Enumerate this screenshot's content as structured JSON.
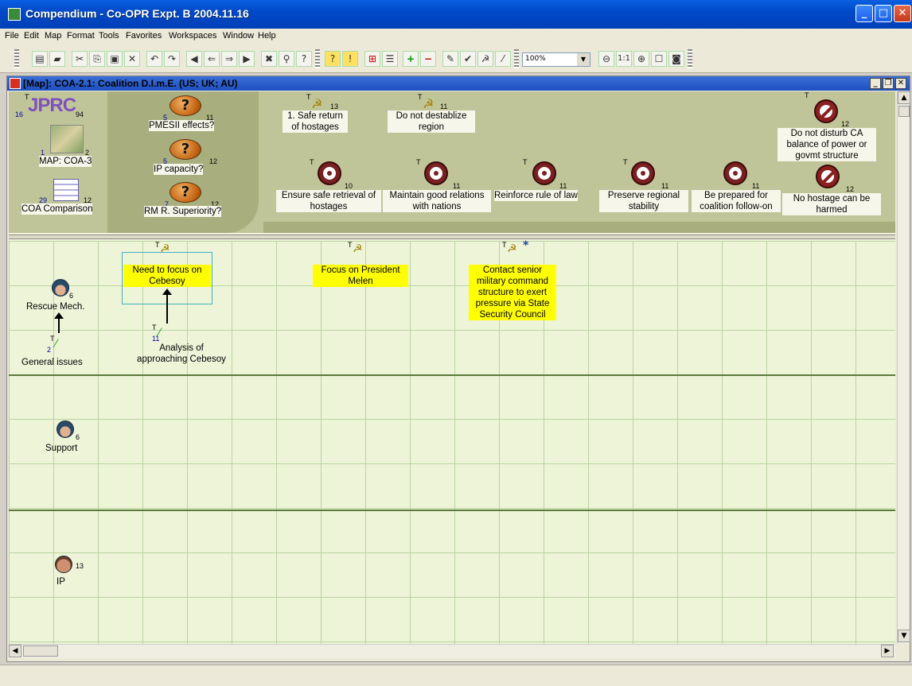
{
  "window": {
    "title": "Compendium - Co-OPR Expt. B 2004.11.16",
    "buttons": {
      "minimize": "_",
      "maximize": "□",
      "close": "✕"
    }
  },
  "menu": [
    "File",
    "Edit",
    "Map",
    "Format",
    "Tools",
    "Favorites",
    "Workspaces",
    "Window",
    "Help"
  ],
  "toolbar": {
    "zoom_value": "100%",
    "zoom_one_to_one": "1:1",
    "icons": [
      "open-folder-icon",
      "open-icon",
      "cut-icon",
      "copy-icon",
      "paste-icon",
      "delete-icon",
      "undo-icon",
      "redo-icon",
      "back-icon",
      "back-arrow-icon",
      "forward-arrow-icon",
      "forward-icon",
      "map-icon",
      "search-icon",
      "help-icon",
      "question-node-icon",
      "idea-node-icon",
      "map-node-icon",
      "list-node-icon",
      "pro-node-icon",
      "con-node-icon",
      "reference-node-icon",
      "decision-node-icon",
      "sickle-node-icon",
      "argument-node-icon",
      "zoom-out-icon",
      "zoom-in-icon",
      "fit-icon",
      "focus-icon"
    ]
  },
  "map_window": {
    "title": "[Map]: COA-2.1: Coalition D.I.m.E. (US; UK; AU)"
  },
  "banner": {
    "jprc": {
      "label": "JPRC",
      "t": "T",
      "left": "16",
      "right": "94"
    },
    "map_coa": {
      "label": "MAP: COA-3",
      "left": "1",
      "right": "2"
    },
    "coa_comparison": {
      "label": "COA Comparison",
      "left": "29",
      "right": "12"
    },
    "questions": [
      {
        "label": "PMESII  effects?",
        "left": "5",
        "right": "11"
      },
      {
        "label": "IP capacity?",
        "left": "5",
        "right": "12"
      },
      {
        "label": "RM R. Superiority?",
        "left": "7",
        "right": "12"
      }
    ],
    "goals_top": [
      {
        "label": "1. Safe return of hostages",
        "t": "T",
        "num": "13"
      },
      {
        "label": "Do not destablize region",
        "t": "T",
        "num": "11"
      }
    ],
    "targets": [
      {
        "label": "Ensure safe retrieval of hostages",
        "t": "T",
        "num": "10"
      },
      {
        "label": "Maintain good relations with nations",
        "t": "T",
        "num": "11"
      },
      {
        "label": "Reinforce rule of law",
        "t": "T",
        "num": "11"
      },
      {
        "label": "Preserve regional stability",
        "t": "T",
        "num": "11"
      },
      {
        "label": "Be prepared for coalition follow-on",
        "t": "",
        "num": "11"
      }
    ],
    "constraints": [
      {
        "label": "Do not disturb CA balance of power or govmt structure",
        "t": "T",
        "num": "12"
      },
      {
        "label": "No hostage can be harmed",
        "t": "",
        "num": "12"
      }
    ]
  },
  "lanes": [
    {
      "name": "Rescue Mech.",
      "badge": "6",
      "nodes": {
        "general_issues": {
          "label": "General issues",
          "t": "T",
          "num": "2"
        },
        "analysis": {
          "label": "Analysis of approaching Cebesoy",
          "t": "T",
          "num": "11"
        },
        "focus_cebesoy": {
          "label": "Need to focus on Cebesoy",
          "t": "T"
        },
        "focus_melen": {
          "label": "Focus on President Melen",
          "t": "T"
        },
        "contact": {
          "label": "Contact senior military command structure to exert pressure via State Security Council",
          "t": "T",
          "star": "*"
        }
      }
    },
    {
      "name": "Support",
      "badge": "6"
    },
    {
      "name": "IP",
      "badge": "13"
    }
  ],
  "colors": {
    "highlight": "#ffff00",
    "banner": "#c0c599",
    "grid": "#eef4d8",
    "titlebar": "#0049c8"
  }
}
